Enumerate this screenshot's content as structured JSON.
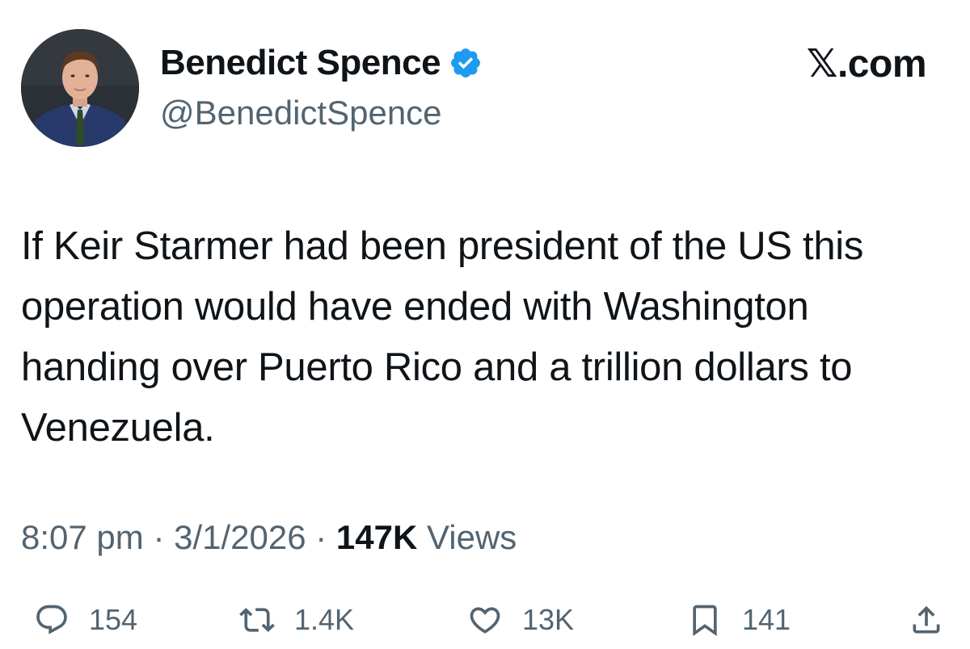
{
  "author": {
    "display_name": "Benedict Spence",
    "handle": "@BenedictSpence",
    "verified": true,
    "verified_color": "#1d9bf0"
  },
  "brand": "𝕏.com",
  "tweet": {
    "text": "If Keir Starmer had been president of the US this operation would have ended with Washington handing over Puerto Rico and a trillion dollars to Venezuela.",
    "time": "8:07 pm",
    "date": "3/1/2026",
    "views_count": "147K",
    "views_label": "Views"
  },
  "actions": {
    "replies": "154",
    "reposts": "1.4K",
    "likes": "13K",
    "bookmarks": "141"
  },
  "icons": {
    "reply": "speech-bubble-icon",
    "repost": "repost-arrows-icon",
    "like": "heart-icon",
    "bookmark": "bookmark-icon",
    "share": "share-upload-icon"
  },
  "colors": {
    "text_primary": "#0f1419",
    "text_secondary": "#536471",
    "background": "#ffffff"
  }
}
